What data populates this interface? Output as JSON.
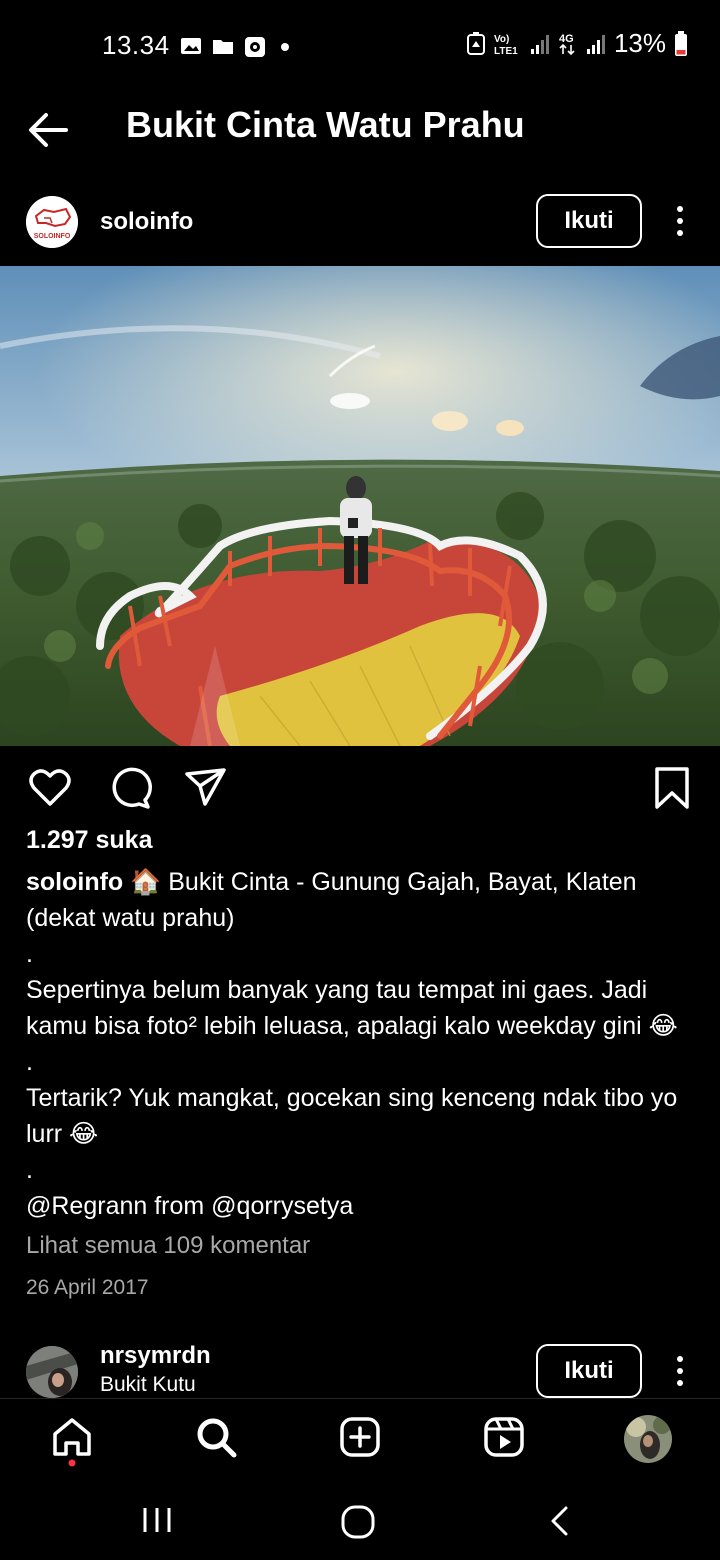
{
  "status_bar": {
    "time": "13.34",
    "battery": "13%",
    "network_label": "4G"
  },
  "header": {
    "title": "Bukit Cinta Watu Prahu"
  },
  "post": {
    "username": "soloinfo",
    "avatar_text": "SOLOINFO",
    "follow_label": "Ikuti",
    "likes": "1.297 suka",
    "caption_user": "soloinfo",
    "caption_emoji": "🏠",
    "caption_line1": " Bukit Cinta - Gunung Gajah, Bayat, Klaten (dekat watu prahu)",
    "dot1": ".",
    "caption_line2": "Sepertinya belum banyak yang tau tempat ini gaes. Jadi kamu bisa foto² lebih leluasa, apalagi kalo weekday gini 😂",
    "dot2": ".",
    "caption_line3": "Tertarik? Yuk mangkat, gocekan sing kenceng ndak tibo yo lurr 😂",
    "dot3": ".",
    "caption_line4": "@Regrann from @qorrysetya",
    "comments_link": "Lihat semua 109 komentar",
    "date": "26 April 2017"
  },
  "post2": {
    "username": "nrsymrdn",
    "location": "Bukit Kutu",
    "follow_label": "Ikuti"
  },
  "colors": {
    "background": "#000000",
    "secondary_text": "#a8a8a8",
    "notification_dot": "#ff3040"
  },
  "icons": {
    "actions": [
      "heart-icon",
      "comment-icon",
      "share-icon",
      "bookmark-icon"
    ],
    "bottom_nav": [
      "home-icon",
      "search-icon",
      "create-icon",
      "reels-icon",
      "profile-avatar"
    ],
    "system_nav": [
      "recents-icon",
      "home-circle-icon",
      "back-chevron-icon"
    ]
  }
}
